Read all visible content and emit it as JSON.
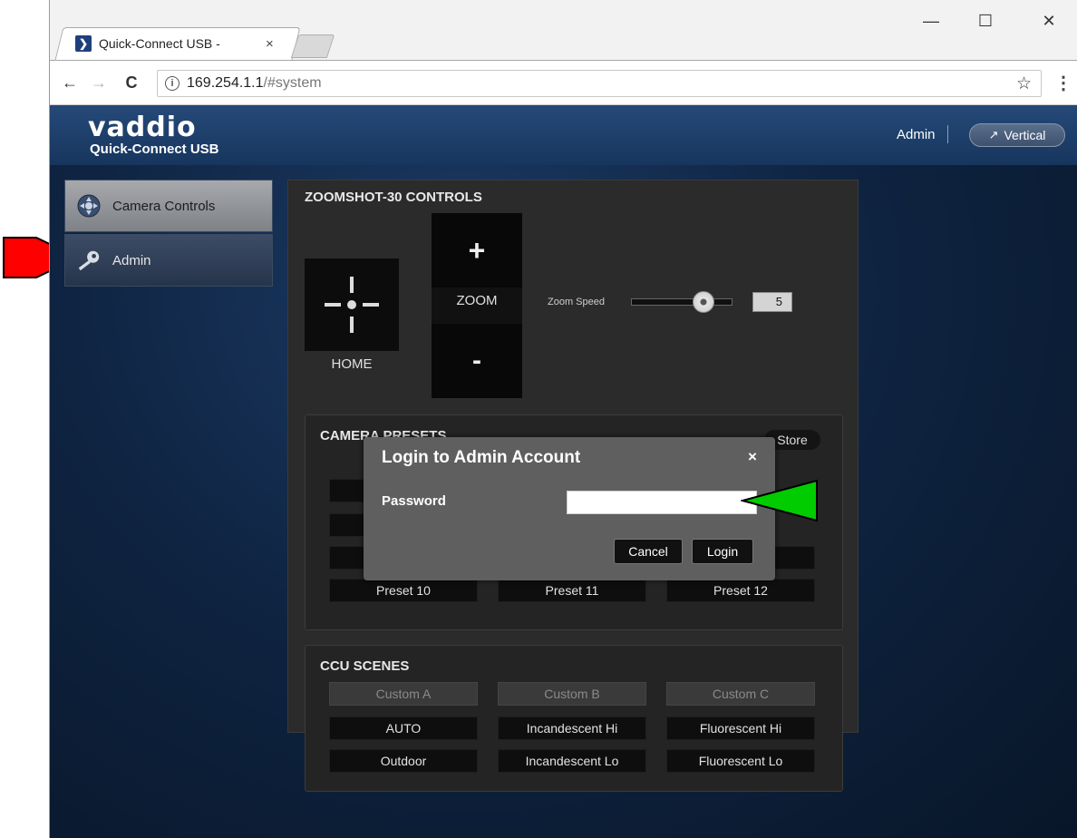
{
  "browser": {
    "tab_title": "Quick-Connect USB -",
    "tab_close": "×",
    "address_host": "169.254.1.1",
    "address_path": "/#system",
    "info_glyph": "i",
    "back_glyph": "←",
    "forward_glyph": "→",
    "reload_glyph": "C",
    "star_glyph": "☆",
    "menu_glyph": "⋮",
    "minimize_glyph": "—",
    "maximize_glyph": "☐",
    "close_glyph": "✕"
  },
  "header": {
    "logo_word": "vaddio",
    "logo_sub": "Quick-Connect USB",
    "user": "Admin",
    "vertical_label": "Vertical",
    "vertical_glyph": "↗"
  },
  "sidebar": {
    "items": [
      {
        "label": "Camera Controls",
        "icon": "camera-controls-icon"
      },
      {
        "label": "Admin",
        "icon": "key-icon"
      }
    ]
  },
  "controls": {
    "title": "ZOOMSHOT-30 CONTROLS",
    "home_label": "HOME",
    "zoom_plus": "+",
    "zoom_label": "ZOOM",
    "zoom_minus": "-",
    "zoom_speed_label": "Zoom Speed",
    "zoom_speed_value": "5",
    "zoom_speed_max": 7
  },
  "presets": {
    "title": "CAMERA PRESETS",
    "store_label": "Store",
    "visible_buttons": [
      "Preset 10",
      "Preset 11",
      "Preset 12"
    ]
  },
  "ccu": {
    "title": "CCU SCENES",
    "rows": [
      [
        {
          "label": "Custom A",
          "enabled": false
        },
        {
          "label": "Custom B",
          "enabled": false
        },
        {
          "label": "Custom C",
          "enabled": false
        }
      ],
      [
        {
          "label": "AUTO",
          "enabled": true
        },
        {
          "label": "Incandescent Hi",
          "enabled": true
        },
        {
          "label": "Fluorescent Hi",
          "enabled": true
        }
      ],
      [
        {
          "label": "Outdoor",
          "enabled": true
        },
        {
          "label": "Incandescent Lo",
          "enabled": true
        },
        {
          "label": "Fluorescent Lo",
          "enabled": true
        }
      ]
    ]
  },
  "modal": {
    "title": "Login to Admin Account",
    "close_glyph": "×",
    "password_label": "Password",
    "password_value": "",
    "cancel_label": "Cancel",
    "login_label": "Login"
  },
  "colors": {
    "header_bg": "#1d3f6b",
    "annotation_red": "#ff0000",
    "annotation_green": "#00cc00"
  }
}
